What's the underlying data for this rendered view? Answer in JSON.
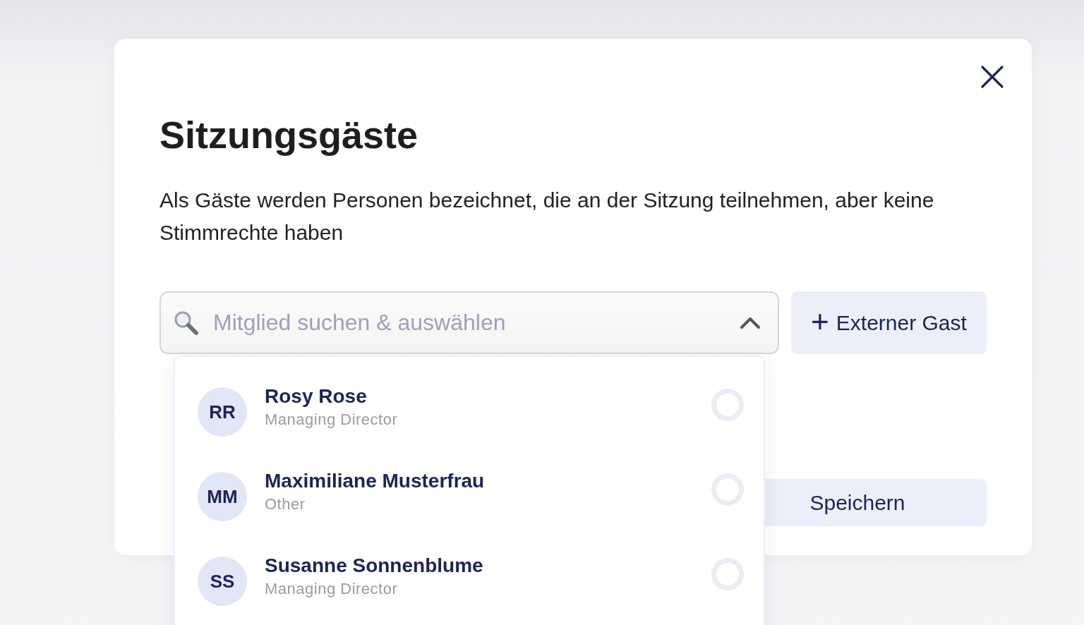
{
  "dialog": {
    "title": "Sitzungsgäste",
    "description": "Als Gäste werden Personen bezeichnet, die an der Sitzung teilnehmen, aber keine Stimmrechte haben"
  },
  "search": {
    "placeholder": "Mitglied suchen & auswählen",
    "expanded": true
  },
  "add_button": {
    "icon": "+",
    "label": "Externer Gast"
  },
  "members": [
    {
      "initials": "RR",
      "name": "Rosy Rose",
      "role": "Managing Director",
      "selected": false
    },
    {
      "initials": "MM",
      "name": "Maximiliane Musterfrau",
      "role": "Other",
      "selected": false
    },
    {
      "initials": "SS",
      "name": "Susanne Sonnenblume",
      "role": "Managing Director",
      "selected": false
    }
  ],
  "save_button": {
    "label": "Speichern"
  }
}
